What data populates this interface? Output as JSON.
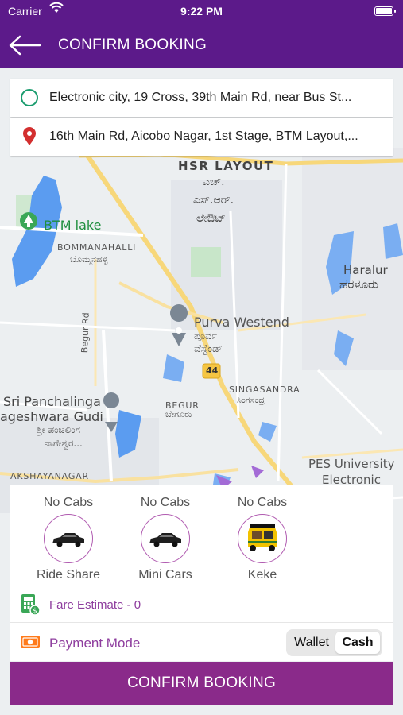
{
  "status_bar": {
    "carrier": "Carrier",
    "time": "9:22 PM"
  },
  "header": {
    "title": "CONFIRM BOOKING"
  },
  "pickup": {
    "address": "Electronic city, 19 Cross, 39th Main Rd, near Bus St..."
  },
  "drop": {
    "address": "16th Main Rd, Aicobo Nagar, 1st Stage, BTM Layout,..."
  },
  "map": {
    "labels": {
      "hsr_layout": "HSR LAYOUT",
      "hsr_kn1": "ಎಚ್.",
      "hsr_kn2": "ಎಸ್.ಆರ್.",
      "hsr_kn3": "ಲೇಔಟ್",
      "btm_lake": "BTM lake",
      "bommanahalli": "BOMMANAHALLI",
      "bommanahalli_kn": "ಬೊಮ್ಮನಹಳ್ಳಿ",
      "haralur": "Haralur",
      "haralur_kn": "ಹರಳೂರು",
      "purva_westend": "Purva Westend",
      "purva_kn1": "ಪೂರ್ವ",
      "purva_kn2": "ವೆಸ್ಟೆಂಡ್",
      "begur_rd": "Begur Rd",
      "highway_44": "44",
      "singasandra": "SINGASANDRA",
      "singasandra_kn": "ಸಿಂಗಸಂದ್ರ",
      "begur": "BEGUR",
      "begur_kn": "ಬೇಗೂರು",
      "sri_panchalinga": "Sri Panchalinga",
      "ageshwara_gudi": "ageshwara Gudi",
      "panchalinga_kn1": "ಶ್ರೀ ಪಂಚಲಿಂಗ",
      "panchalinga_kn2": "ನಾಗೇಶ್ವರ...",
      "akshayanagar": "AKSHAYANAGAR",
      "pes_university": "PES University",
      "electronic": "Electronic"
    }
  },
  "cabs": [
    {
      "status": "No Cabs",
      "label": "Ride Share",
      "icon": "car-icon"
    },
    {
      "status": "No Cabs",
      "label": "Mini Cars",
      "icon": "car-icon"
    },
    {
      "status": "No Cabs",
      "label": "Keke",
      "icon": "auto-rickshaw-icon"
    }
  ],
  "fare": {
    "text": "Fare Estimate - 0"
  },
  "payment": {
    "label": "Payment Mode",
    "options": [
      "Wallet",
      "Cash"
    ],
    "selected": "Cash"
  },
  "confirm_button": {
    "label": "CONFIRM BOOKING"
  },
  "colors": {
    "brand": "#5c1a8a",
    "button": "#8a2a8a",
    "accent_text": "#8e3d9e",
    "pickup": "#1a9c6e",
    "drop": "#d32f2f"
  }
}
